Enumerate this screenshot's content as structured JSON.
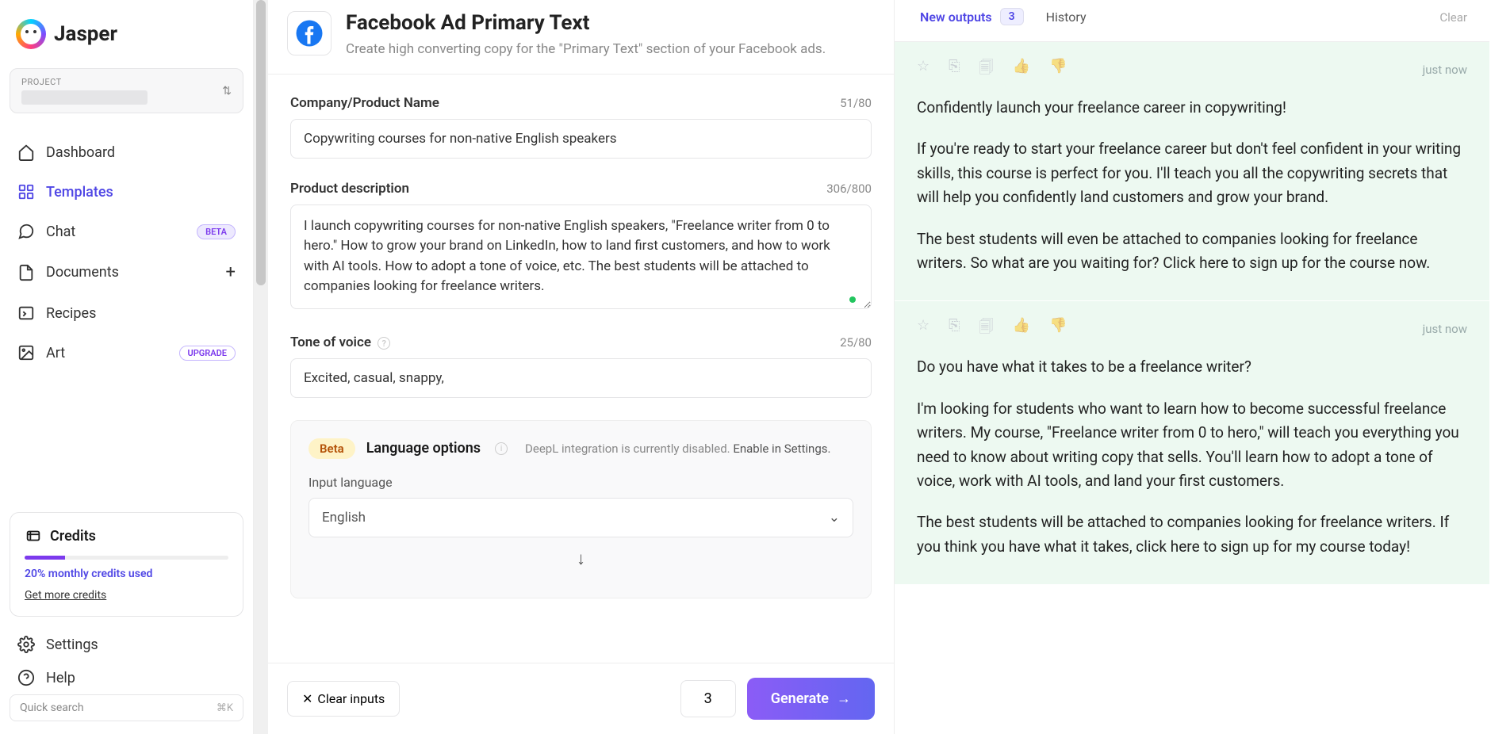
{
  "brand": "Jasper",
  "project_label": "PROJECT",
  "nav": {
    "dashboard": "Dashboard",
    "templates": "Templates",
    "chat": "Chat",
    "chat_badge": "BETA",
    "documents": "Documents",
    "recipes": "Recipes",
    "art": "Art",
    "art_badge": "UPGRADE"
  },
  "credits": {
    "title": "Credits",
    "percent": 20,
    "usage_text": "20% monthly credits used",
    "link": "Get more credits"
  },
  "settings_label": "Settings",
  "help_label": "Help",
  "search_placeholder": "Quick search",
  "search_kbd": "⌘K",
  "template": {
    "title": "Facebook Ad Primary Text",
    "subtitle": "Create high converting copy for the \"Primary Text\" section of your Facebook ads."
  },
  "fields": {
    "company": {
      "label": "Company/Product Name",
      "count": "51/80",
      "value": "Copywriting courses for non-native English speakers"
    },
    "description": {
      "label": "Product description",
      "count": "306/800",
      "value": "I launch copywriting courses for non-native English speakers, \"Freelance writer from 0 to hero.\" How to grow your brand on LinkedIn, how to land first customers, and how to work with AI tools. How to adopt a tone of voice, etc. The best students will be attached to companies looking for freelance writers."
    },
    "tone": {
      "label": "Tone of voice",
      "count": "25/80",
      "value": "Excited, casual, snappy,"
    }
  },
  "language": {
    "beta": "Beta",
    "title": "Language options",
    "note_disabled": "DeepL integration is currently disabled. ",
    "note_link": "Enable in Settings.",
    "input_label": "Input language",
    "input_value": "English"
  },
  "footer": {
    "clear": "Clear inputs",
    "count": "3",
    "generate": "Generate"
  },
  "tabs": {
    "new_outputs": "New outputs",
    "count": "3",
    "history": "History",
    "clear": "Clear"
  },
  "outputs": [
    {
      "time": "just now",
      "paragraphs": [
        "Confidently launch your freelance career in copywriting!",
        "If you're ready to start your freelance career but don't feel confident in your writing skills, this course is perfect for you. I'll teach you all the copywriting secrets that will help you confidently land customers and grow your brand.",
        "The best students will even be attached to companies looking for freelance writers. So what are you waiting for? Click here to sign up for the course now."
      ]
    },
    {
      "time": "just now",
      "paragraphs": [
        "Do you have what it takes to be a freelance writer?",
        "I'm looking for students who want to learn how to become successful freelance writers. My course, \"Freelance writer from 0 to hero,\" will teach you everything you need to know about writing copy that sells. You'll learn how to adopt a tone of voice, work with AI tools, and land your first customers.",
        "The best students will be attached to companies looking for freelance writers. If you think you have what it takes, click here to sign up for my course today!"
      ]
    }
  ]
}
